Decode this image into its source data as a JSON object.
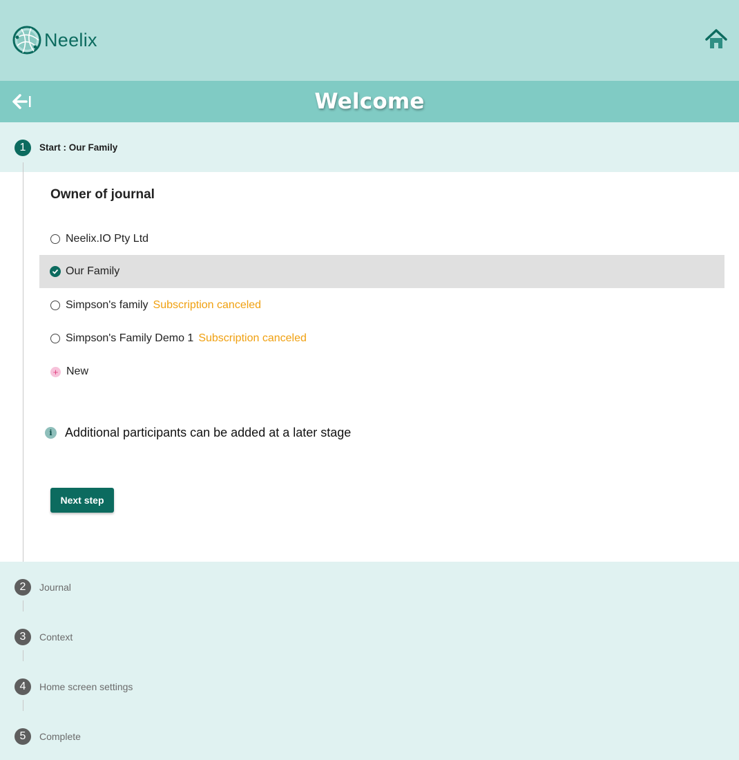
{
  "header": {
    "brand": "Neelix",
    "home_icon": "home-icon"
  },
  "titlebar": {
    "title": "Welcome",
    "back_icon": "arrow-left-bar-icon"
  },
  "stepper": {
    "steps": [
      {
        "number": "1",
        "label": "Start : Our Family",
        "state": "active"
      },
      {
        "number": "2",
        "label": "Journal",
        "state": "pending"
      },
      {
        "number": "3",
        "label": "Context",
        "state": "pending"
      },
      {
        "number": "4",
        "label": "Home screen settings",
        "state": "pending"
      },
      {
        "number": "5",
        "label": "Complete",
        "state": "pending"
      }
    ]
  },
  "owner": {
    "title": "Owner of journal",
    "options": [
      {
        "label": "Neelix.IO Pty Ltd",
        "status": "",
        "selected": false
      },
      {
        "label": "Our Family",
        "status": "",
        "selected": true
      },
      {
        "label": "Simpson's family",
        "status": "Subscription canceled",
        "selected": false
      },
      {
        "label": "Simpson's Family Demo 1",
        "status": "Subscription canceled",
        "selected": false
      }
    ],
    "new_label": "New"
  },
  "info": {
    "text": "Additional participants can be added at a later stage"
  },
  "actions": {
    "next_label": "Next step"
  },
  "colors": {
    "brand": "#0c6b5f",
    "header_bg": "#b2dfdb",
    "titlebar_bg": "#80cbc4",
    "stepper_bg": "#e0f2f1",
    "warning": "#f0a010",
    "selected_row": "#e0e0e0"
  }
}
